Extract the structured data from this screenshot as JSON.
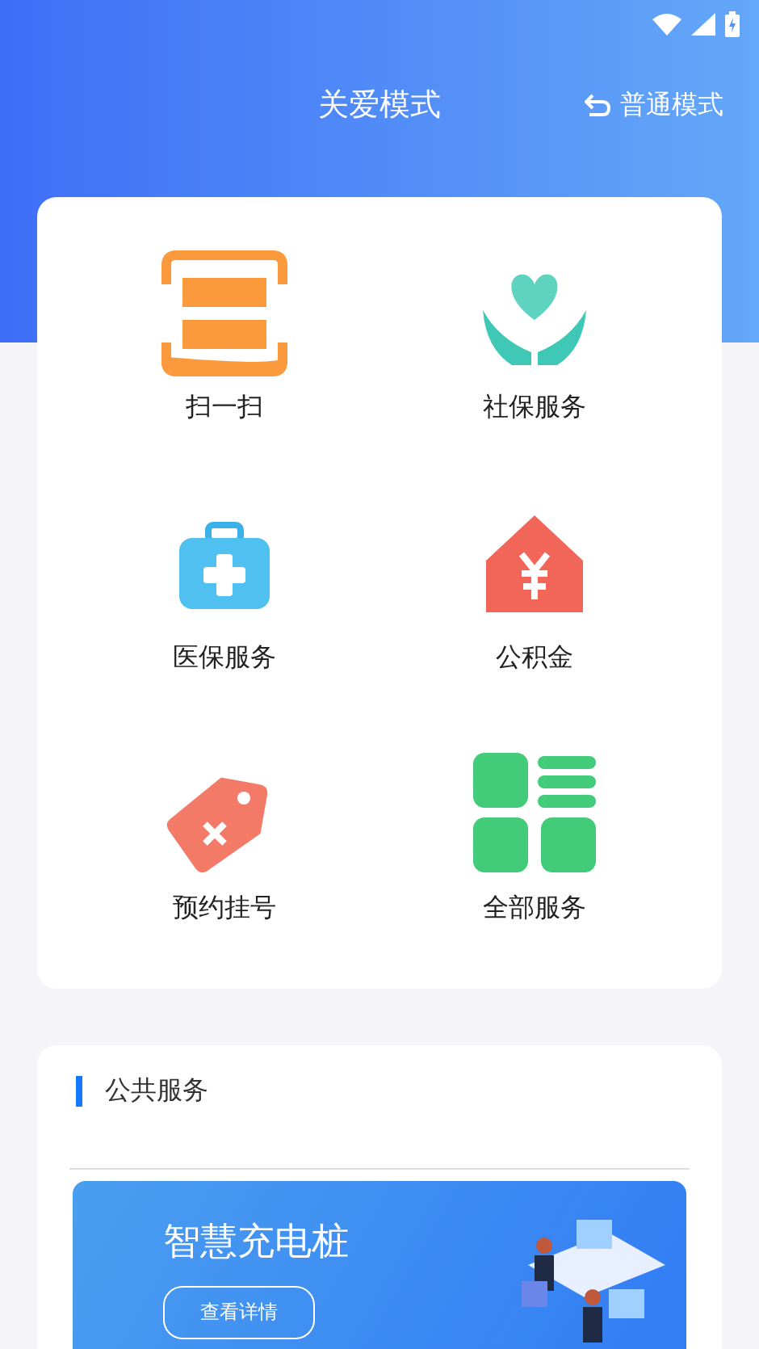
{
  "header": {
    "title": "关爱模式",
    "switch_link": "普通模式"
  },
  "services": [
    {
      "label": "扫一扫"
    },
    {
      "label": "社保服务"
    },
    {
      "label": "医保服务"
    },
    {
      "label": "公积金"
    },
    {
      "label": "预约挂号"
    },
    {
      "label": "全部服务"
    }
  ],
  "public_section": {
    "title": "公共服务",
    "banner": {
      "title": "智慧充电桩",
      "button": "查看详情"
    }
  }
}
